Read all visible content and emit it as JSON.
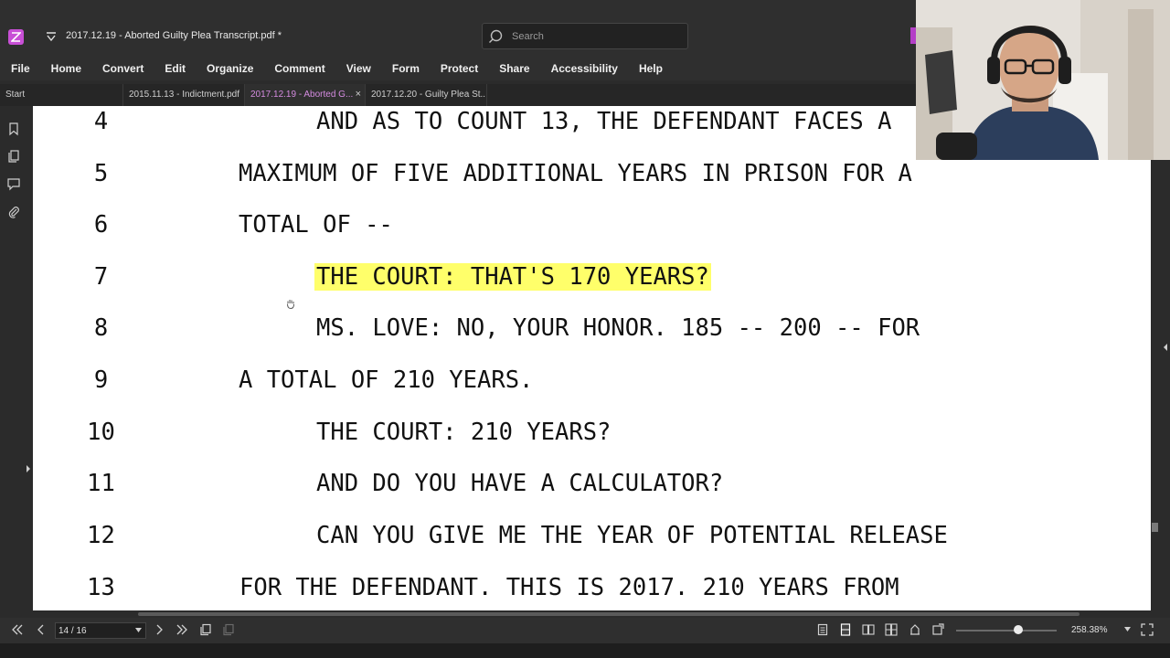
{
  "window": {
    "title": "2017.12.19 - Aborted Guilty Plea Transcript.pdf *"
  },
  "search": {
    "placeholder": "Search"
  },
  "menu": [
    "File",
    "Home",
    "Convert",
    "Edit",
    "Organize",
    "Comment",
    "View",
    "Form",
    "Protect",
    "Share",
    "Accessibility",
    "Help"
  ],
  "tabs": [
    {
      "label": "Start"
    },
    {
      "label": "2015.11.13 - Indictment.pdf"
    },
    {
      "label": "2017.12.19 - Aborted G...",
      "close": "×"
    },
    {
      "label": "2017.12.20 - Guilty Plea St..."
    }
  ],
  "transcript": {
    "lines": [
      {
        "num": "4",
        "text": "AND AS TO COUNT 13, THE DEFENDANT FACES A"
      },
      {
        "num": "5",
        "text": "MAXIMUM OF FIVE ADDITIONAL YEARS IN PRISON FOR A"
      },
      {
        "num": "6",
        "text": "TOTAL OF --"
      },
      {
        "num": "7",
        "text": "THE COURT:  THAT'S 170 YEARS?"
      },
      {
        "num": "8",
        "text": "MS. LOVE:  NO, YOUR HONOR.  185 -- 200 -- FOR"
      },
      {
        "num": "9",
        "text": "A TOTAL OF 210 YEARS."
      },
      {
        "num": "10",
        "text": "THE COURT:  210 YEARS?"
      },
      {
        "num": "11",
        "text": "AND DO YOU HAVE A CALCULATOR?"
      },
      {
        "num": "12",
        "text": "CAN YOU GIVE ME THE YEAR OF POTENTIAL RELEASE"
      },
      {
        "num": "13",
        "text": "FOR THE DEFENDANT.  THIS IS 2017.  210 YEARS FROM"
      }
    ]
  },
  "status": {
    "page": "14 / 16",
    "zoom": "258.38%",
    "zoom_level": 0.62
  },
  "colors": {
    "accent": "#c84fd6",
    "highlight": "#ffff6a"
  }
}
